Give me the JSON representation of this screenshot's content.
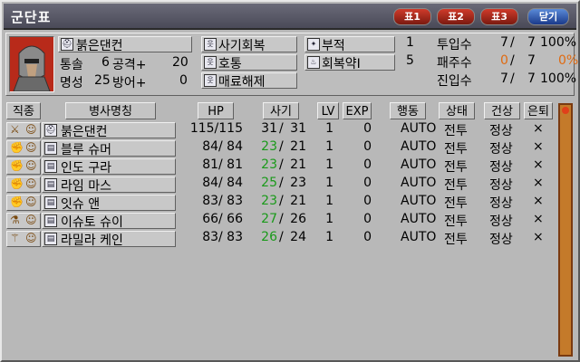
{
  "window": {
    "title": "군단표"
  },
  "title_buttons": [
    {
      "label": "표1"
    },
    {
      "label": "표2"
    },
    {
      "label": "표3"
    },
    {
      "label": "닫기"
    }
  ],
  "commander": {
    "name": "붉은댄컨",
    "stat1_label": "통솔",
    "stat1_value": "6",
    "stat2_label": "공격+",
    "stat2_value": "20",
    "stat3_label": "명성",
    "stat3_value": "25",
    "stat4_label": "방어+",
    "stat4_value": "0"
  },
  "commands": [
    "사기회복",
    "호통",
    "매료해제"
  ],
  "items": [
    {
      "label": "부적",
      "count": "1"
    },
    {
      "label": "회복약Ⅰ",
      "count": "5"
    }
  ],
  "ratios": [
    {
      "label": "투입수",
      "a": "7",
      "b": "7",
      "pct": "100%",
      "a_color": "#000000",
      "pct_color": "#000000"
    },
    {
      "label": "패주수",
      "a": "0",
      "b": "7",
      "pct": "0%",
      "a_color": "#e06a10",
      "pct_color": "#e06a10"
    },
    {
      "label": "진입수",
      "a": "7",
      "b": "7",
      "pct": "100%",
      "a_color": "#000000",
      "pct_color": "#000000"
    }
  ],
  "table": {
    "headers": {
      "type": "직종",
      "name": "병사명칭",
      "hp": "HP",
      "morale": "사기",
      "lv": "LV",
      "exp": "EXP",
      "action": "행동",
      "status": "상태",
      "health": "건상",
      "retreat": "은퇴"
    },
    "rows": [
      {
        "name": "붉은댄컨",
        "hp": "115/115",
        "morale_cur": "31",
        "morale_max": "31",
        "lv": "1",
        "exp": "0",
        "action": "AUTO",
        "status": "전투",
        "health": "정상",
        "retreat": "×",
        "morale_green": false,
        "type_icon": "sword-icon"
      },
      {
        "name": "블루 슈머",
        "hp": "84/ 84",
        "morale_cur": "23",
        "morale_max": "21",
        "lv": "1",
        "exp": "0",
        "action": "AUTO",
        "status": "전투",
        "health": "정상",
        "retreat": "×",
        "morale_green": true,
        "type_icon": "fist-icon"
      },
      {
        "name": "인도 구라",
        "hp": "81/ 81",
        "morale_cur": "23",
        "morale_max": "21",
        "lv": "1",
        "exp": "0",
        "action": "AUTO",
        "status": "전투",
        "health": "정상",
        "retreat": "×",
        "morale_green": true,
        "type_icon": "fist-icon"
      },
      {
        "name": "라임 마스",
        "hp": "84/ 84",
        "morale_cur": "25",
        "morale_max": "23",
        "lv": "1",
        "exp": "0",
        "action": "AUTO",
        "status": "전투",
        "health": "정상",
        "retreat": "×",
        "morale_green": true,
        "type_icon": "fist-icon"
      },
      {
        "name": "잇슈 앤",
        "hp": "83/ 83",
        "morale_cur": "23",
        "morale_max": "21",
        "lv": "1",
        "exp": "0",
        "action": "AUTO",
        "status": "전투",
        "health": "정상",
        "retreat": "×",
        "morale_green": true,
        "type_icon": "fist-icon"
      },
      {
        "name": "이슈토 슈이",
        "hp": "66/ 66",
        "morale_cur": "27",
        "morale_max": "26",
        "lv": "1",
        "exp": "0",
        "action": "AUTO",
        "status": "전투",
        "health": "정상",
        "retreat": "×",
        "morale_green": true,
        "type_icon": "potion-icon"
      },
      {
        "name": "라밀라 케인",
        "hp": "83/ 83",
        "morale_cur": "26",
        "morale_max": "24",
        "lv": "1",
        "exp": "0",
        "action": "AUTO",
        "status": "전투",
        "health": "정상",
        "retreat": "×",
        "morale_green": true,
        "type_icon": "staff-icon"
      }
    ]
  },
  "colors": {
    "green": "#1a9a1a",
    "orange": "#e06a10"
  }
}
